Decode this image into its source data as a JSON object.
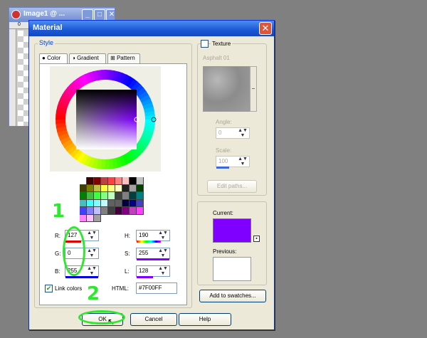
{
  "background_window": {
    "title": "Image1 @ ...",
    "buttons": [
      "_",
      "□",
      "✕"
    ],
    "ruler_mark": "0"
  },
  "dialog": {
    "title": "Material",
    "close_glyph": "✕"
  },
  "style_group": {
    "legend": "Style",
    "tabs": [
      {
        "label": "Color",
        "icon": "color-dot-icon",
        "active": true
      },
      {
        "label": "Gradient",
        "icon": "gradient-icon",
        "active": false
      },
      {
        "label": "Pattern",
        "icon": "pattern-icon",
        "active": false
      }
    ]
  },
  "color": {
    "r_label": "R:",
    "r_value": "127",
    "g_label": "G:",
    "g_value": "0",
    "b_label": "B:",
    "b_value": "255",
    "h_label": "H:",
    "h_value": "190",
    "s_label": "S:",
    "s_value": "255",
    "l_label": "L:",
    "l_value": "128",
    "link_colors_label": "Link colors",
    "link_colors_checked": true,
    "html_label": "HTML:",
    "html_value": "#7F00FF",
    "current_hex": "#7F00FF",
    "previous_hex": "#FFFFFF"
  },
  "palette": [
    "#ffffff",
    "#400000",
    "#800000",
    "#c04040",
    "#ff4040",
    "#ff8080",
    "#ffc0c0",
    "#000000",
    "#c0c0c0",
    "#404000",
    "#808000",
    "#c0c040",
    "#ffff40",
    "#ffff80",
    "#ffffc0",
    "#202020",
    "#a0a0a0",
    "#004000",
    "#008000",
    "#40c040",
    "#40ff40",
    "#80ff80",
    "#c0ffc0",
    "#404040",
    "#808080",
    "#004040",
    "#008080",
    "#40c0c0",
    "#40ffff",
    "#80ffff",
    "#c0ffff",
    "#606060",
    "#606060",
    "#000040",
    "#000080",
    "#4040c0",
    "#4040ff",
    "#8080ff",
    "#c0c0ff",
    "#808080",
    "#404040",
    "#400040",
    "#800080",
    "#c040c0",
    "#ff40ff",
    "#ff80ff",
    "#ffc0ff",
    "#a0a0a0"
  ],
  "texture": {
    "checkbox_label": "Texture",
    "checked": false,
    "name": "Asphalt 01",
    "angle_label": "Angle:",
    "angle_value": "0",
    "scale_label": "Scale:",
    "scale_value": "100",
    "edit_paths_label": "Edit paths..."
  },
  "swatch": {
    "current_label": "Current:",
    "previous_label": "Previous:"
  },
  "buttons": {
    "add_to_swatches": "Add to swatches...",
    "ok": "OK",
    "cancel": "Cancel",
    "help": "Help"
  },
  "annotations": {
    "step1": "1",
    "step2": "2",
    "color": "#2ee82e"
  }
}
